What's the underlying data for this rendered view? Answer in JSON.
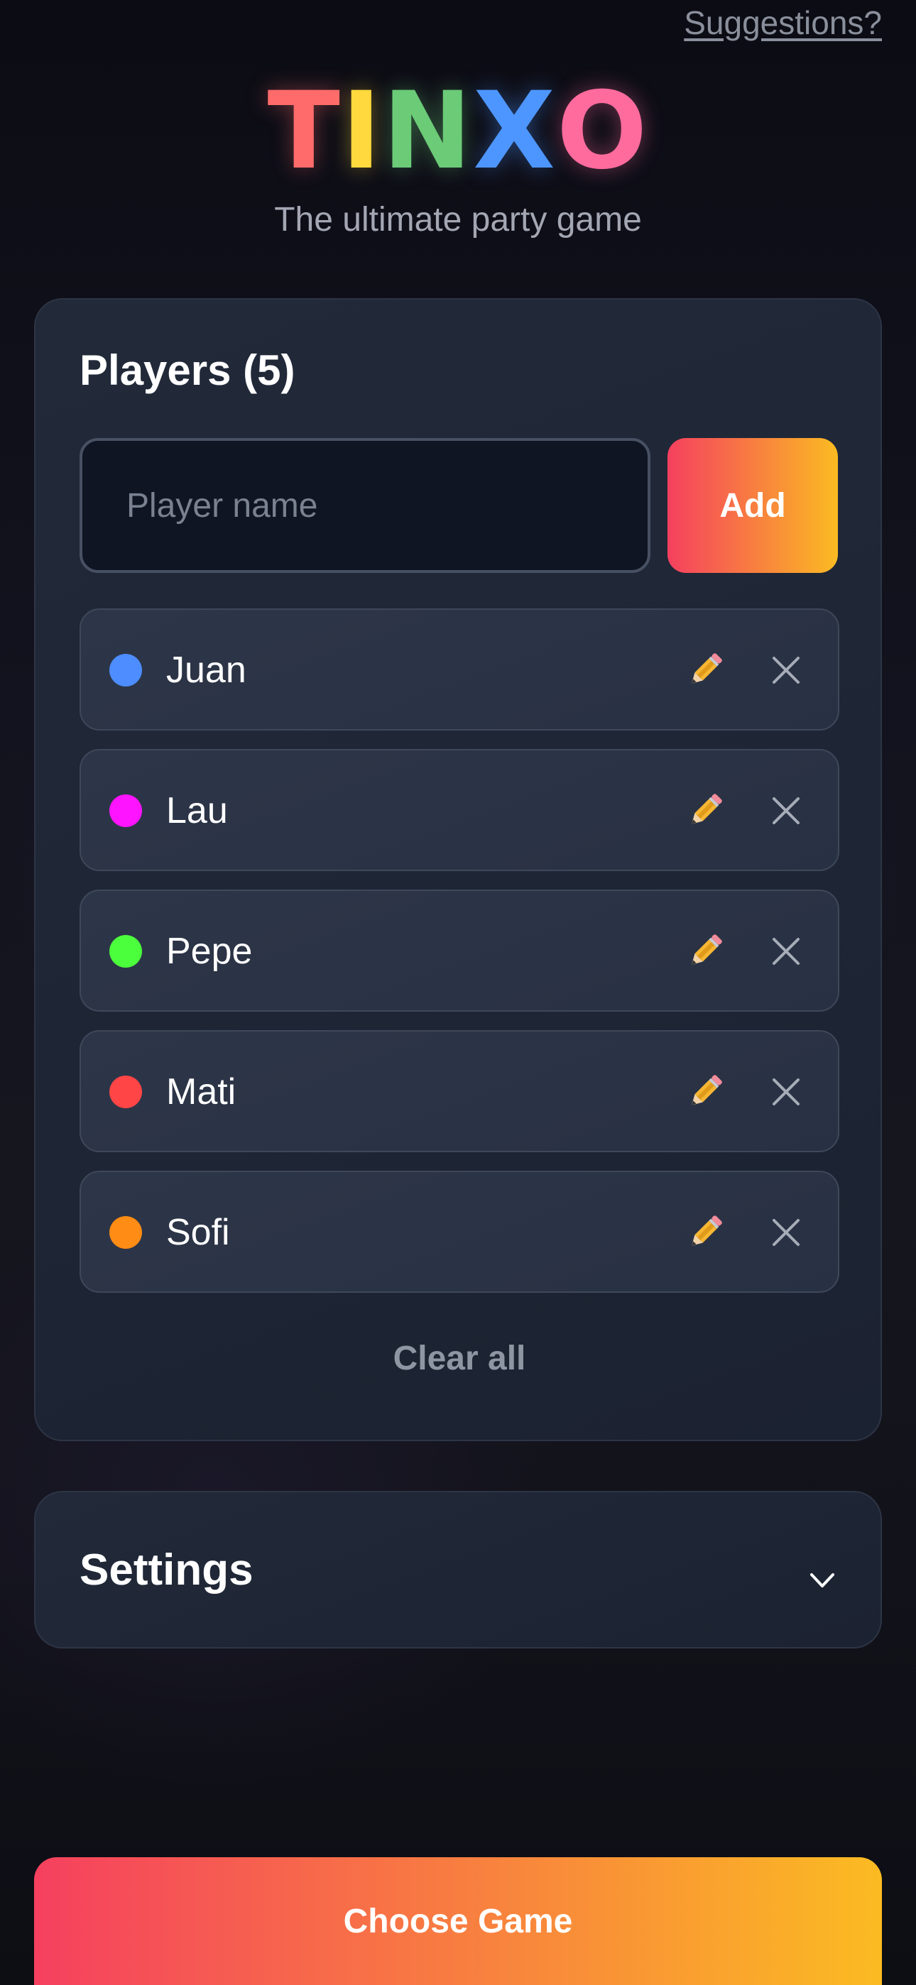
{
  "header": {
    "suggestions_link": "Suggestions?",
    "logo_letters": [
      {
        "char": "T",
        "color": "#ff6b6b"
      },
      {
        "char": "I",
        "color": "#ffd93d"
      },
      {
        "char": "N",
        "color": "#6bcb77"
      },
      {
        "char": "X",
        "color": "#4d96ff"
      },
      {
        "char": "O",
        "color": "#ff6b9d"
      }
    ],
    "tagline": "The ultimate party game"
  },
  "players": {
    "title": "Players (5)",
    "input_placeholder": "Player name",
    "input_value": "",
    "add_label": "Add",
    "edit_icon": "pencil-icon",
    "remove_icon": "close-icon",
    "items": [
      {
        "name": "Juan",
        "color": "#4d8dff"
      },
      {
        "name": "Lau",
        "color": "#ff14ff"
      },
      {
        "name": "Pepe",
        "color": "#4cff3c"
      },
      {
        "name": "Mati",
        "color": "#ff4545"
      },
      {
        "name": "Sofi",
        "color": "#ff8c14"
      }
    ],
    "clear_all_label": "Clear all"
  },
  "settings": {
    "title": "Settings",
    "icon": "chevron-down-icon"
  },
  "footer": {
    "choose_game_label": "Choose Game"
  },
  "colors": {
    "accent_start": "#f5405f",
    "accent_end": "#fbbb22"
  }
}
